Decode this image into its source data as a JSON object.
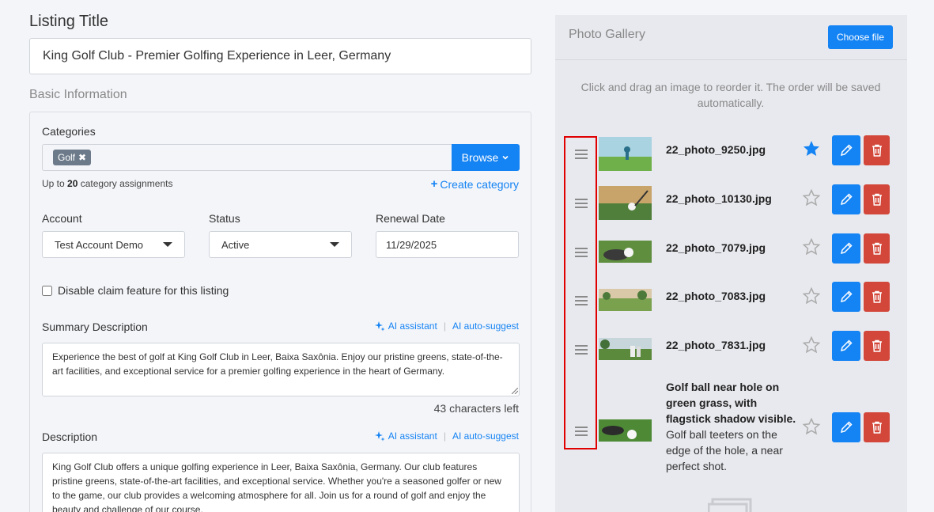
{
  "listing": {
    "title_label": "Listing Title",
    "title_value": "King Golf Club - Premier Golfing Experience in Leer, Germany",
    "section_label": "Basic Information"
  },
  "categories": {
    "label": "Categories",
    "tags": [
      "Golf"
    ],
    "browse_label": "Browse",
    "hint_prefix": "Up to",
    "hint_count": "20",
    "hint_suffix": "category assignments",
    "create_label": "Create category"
  },
  "account": {
    "label": "Account",
    "value": "Test Account Demo"
  },
  "status": {
    "label": "Status",
    "value": "Active"
  },
  "renewal": {
    "label": "Renewal Date",
    "value": "11/29/2025"
  },
  "claim": {
    "label": "Disable claim feature for this listing",
    "checked": false
  },
  "summary": {
    "label": "Summary Description",
    "ai_assistant": "AI assistant",
    "ai_suggest": "AI auto-suggest",
    "text": "Experience the best of golf at King Golf Club in Leer, Baixa Saxônia. Enjoy our pristine greens, state-of-the-art facilities, and exceptional service for a premier golfing experience in the heart of Germany.",
    "chars_left": "43 characters left"
  },
  "description": {
    "label": "Description",
    "ai_assistant": "AI assistant",
    "ai_suggest": "AI auto-suggest",
    "text": "King Golf Club offers a unique golfing experience in Leer, Baixa Saxônia, Germany. Our club features pristine greens, state-of-the-art facilities, and exceptional service. Whether you're a seasoned golfer or new to the game, our club provides a welcoming atmosphere for all. Join us for a round of golf and enjoy the beauty and challenge of our course."
  },
  "gallery": {
    "title": "Photo Gallery",
    "choose_label": "Choose file",
    "note": "Click and drag an image to reorder it. The order will be saved automatically.",
    "photos": [
      {
        "name": "22_photo_9250.jpg",
        "featured": true
      },
      {
        "name": "22_photo_10130.jpg",
        "featured": false
      },
      {
        "name": "22_photo_7079.jpg",
        "featured": false
      },
      {
        "name": "22_photo_7083.jpg",
        "featured": false
      },
      {
        "name": "22_photo_7831.jpg",
        "featured": false
      }
    ],
    "last_photo": {
      "title": "Golf ball near hole on green grass, with flagstick shadow visible.",
      "caption": "Golf ball teeters on the edge of the hole, a near perfect shot.",
      "featured": false
    }
  },
  "colors": {
    "primary": "#1483f3",
    "danger": "#d2473a",
    "highlight": "#e00000"
  }
}
